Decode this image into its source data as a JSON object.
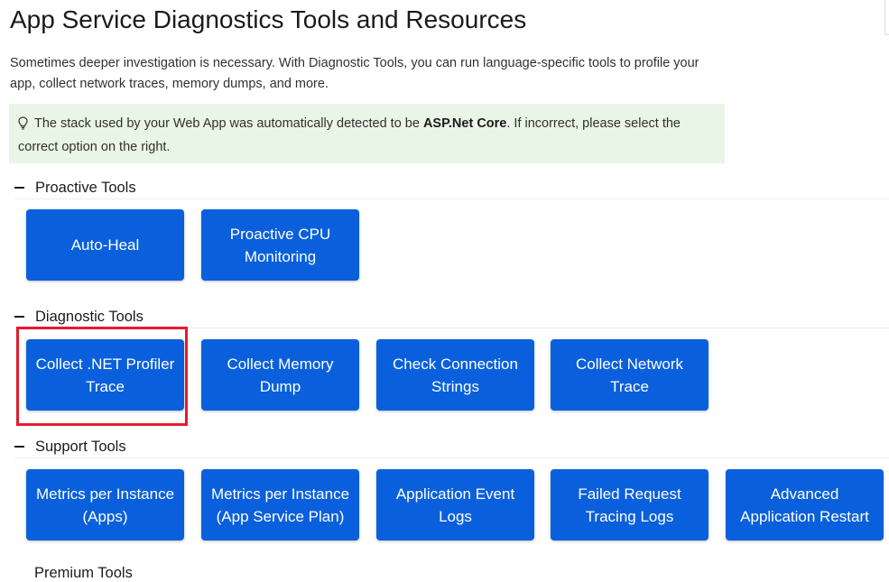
{
  "page": {
    "title": "App Service Diagnostics Tools and Resources",
    "description": "Sometimes deeper investigation is necessary. With Diagnostic Tools, you can run language-specific tools to profile your app, collect network traces, memory dumps, and more."
  },
  "notice": {
    "icon": "lightbulb-icon",
    "text_before": "The stack used by your Web App was automatically detected to be ",
    "stack": "ASP.Net Core",
    "text_after": ". If incorrect, please select the correct option on the right."
  },
  "sections": {
    "proactive": {
      "label": "Proactive Tools",
      "tools": [
        "Auto-Heal",
        "Proactive CPU Monitoring"
      ]
    },
    "diagnostic": {
      "label": "Diagnostic Tools",
      "tools": [
        "Collect .NET Profiler Trace",
        "Collect Memory Dump",
        "Check Connection Strings",
        "Collect Network Trace"
      ]
    },
    "support": {
      "label": "Support Tools",
      "tools": [
        "Metrics per Instance (Apps)",
        "Metrics per Instance (App Service Plan)",
        "Application Event Logs",
        "Failed Request Tracing Logs",
        "Advanced Application Restart"
      ]
    },
    "next_partial": {
      "label": "Premium Tools"
    }
  },
  "colors": {
    "tile": "#0a60dc",
    "notice_bg": "#e9f5e6",
    "highlight": "#e21c2c"
  }
}
